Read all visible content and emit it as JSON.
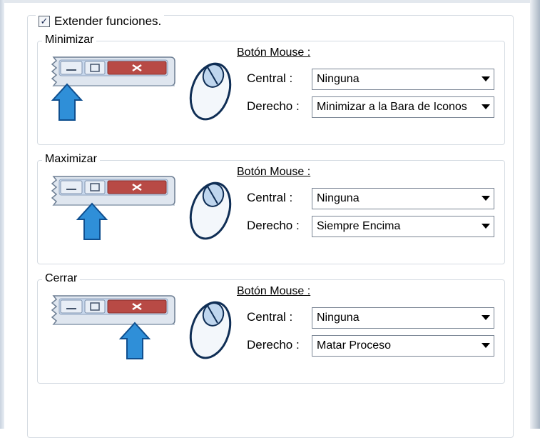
{
  "master": {
    "label": "Extender funciones.",
    "checked": true
  },
  "groups": [
    {
      "title": "Minimizar",
      "mouse_label": "Botón Mouse  :",
      "central_label": "Central  :",
      "central_value": "Ninguna",
      "derecho_label": "Derecho  :",
      "derecho_value": "Minimizar a la Bara de Iconos",
      "highlight": "minimize"
    },
    {
      "title": "Maximizar",
      "mouse_label": "Botón Mouse  :",
      "central_label": "Central  :",
      "central_value": "Ninguna",
      "derecho_label": "Derecho  :",
      "derecho_value": "Siempre Encima",
      "highlight": "maximize"
    },
    {
      "title": "Cerrar",
      "mouse_label": "Botón Mouse  :",
      "central_label": "Central  :",
      "central_value": "Ninguna",
      "derecho_label": "Derecho  :",
      "derecho_value": "Matar Proceso",
      "highlight": "close"
    }
  ],
  "icons": {
    "checkbox": "checkmark-icon",
    "dropdown": "chevron-down-icon",
    "mouse": "mouse-icon",
    "arrow": "arrow-up-icon",
    "titlebar": "window-titlebar-icon"
  },
  "colors": {
    "close_button": "#b84a45",
    "arrow": "#2f8fd8",
    "titlebar_blue": "#c9d9ee"
  }
}
